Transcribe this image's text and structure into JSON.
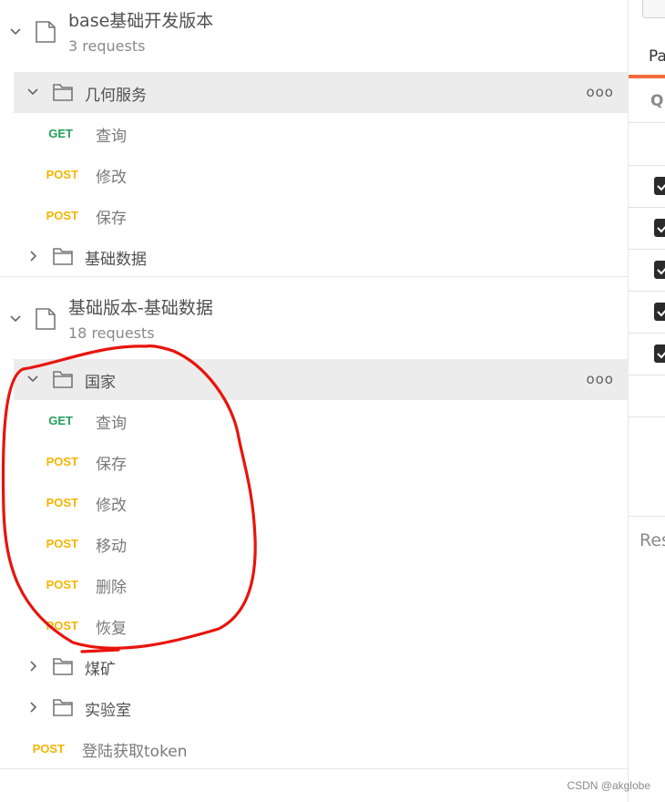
{
  "collections": [
    {
      "name": "base基础开发版本",
      "count": "3 requests"
    },
    {
      "name": "基础版本-基础数据",
      "count": "18 requests"
    }
  ],
  "folders": {
    "geometry": {
      "name": "几何服务",
      "more": "ooo"
    },
    "basic_data": {
      "name": "基础数据"
    },
    "country": {
      "name": "国家",
      "more": "ooo"
    },
    "coal": {
      "name": "煤矿"
    },
    "lab": {
      "name": "实验室"
    }
  },
  "requests_geometry": [
    {
      "method": "GET",
      "name": "查询"
    },
    {
      "method": "POST",
      "name": "修改"
    },
    {
      "method": "POST",
      "name": "保存"
    }
  ],
  "requests_country": [
    {
      "method": "GET",
      "name": "查询"
    },
    {
      "method": "POST",
      "name": "保存"
    },
    {
      "method": "POST",
      "name": "修改"
    },
    {
      "method": "POST",
      "name": "移动"
    },
    {
      "method": "POST",
      "name": "删除"
    },
    {
      "method": "POST",
      "name": "恢复"
    }
  ],
  "root_request": {
    "method": "POST",
    "name": "登陆获取token"
  },
  "right_panel": {
    "tab_partial": "Pa",
    "section_partial": "Q",
    "response_partial": "Res"
  },
  "watermark": "CSDN @akglobe",
  "colors": {
    "get": "#23a05a",
    "post": "#f5b400",
    "accent": "#f26b3a",
    "annotation": "#e8140c"
  }
}
